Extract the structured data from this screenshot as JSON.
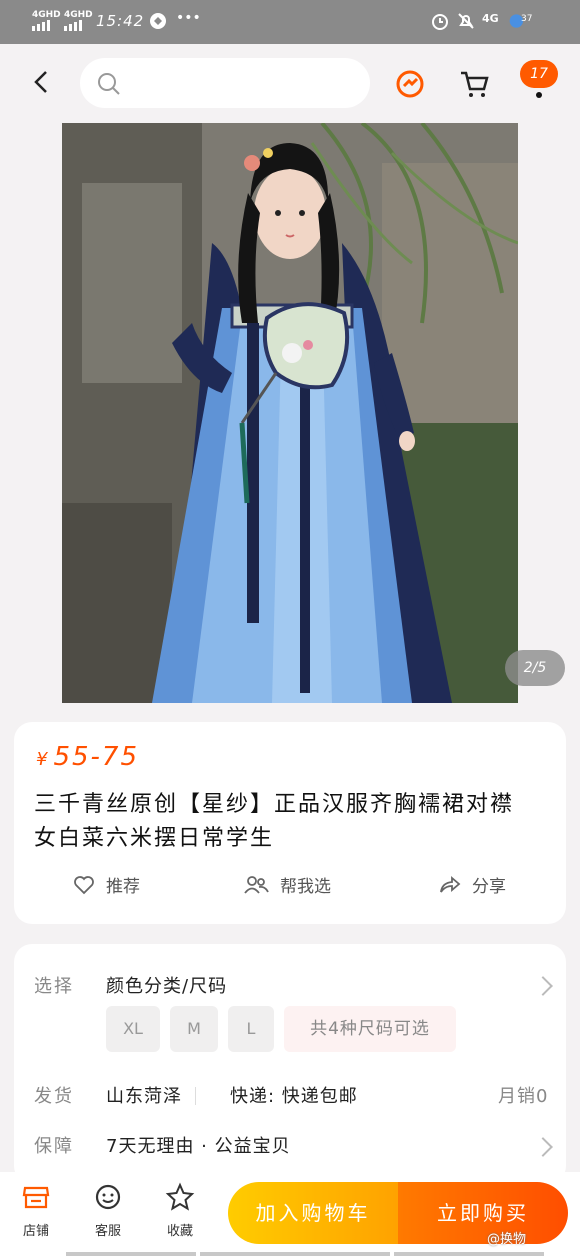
{
  "status_bar": {
    "signal1": "4GHD",
    "signal2": "4GHD",
    "time": "15:42",
    "more": "•••",
    "network": "4G",
    "battery": "37"
  },
  "header": {
    "search_placeholder": "",
    "cart_count": "17"
  },
  "gallery": {
    "counter": "2/5"
  },
  "product": {
    "currency": "¥",
    "price": "55-75",
    "title": "三千青丝原创【星纱】正品汉服齐胸襦裙对襟女白菜六米摆日常学生",
    "actions": [
      {
        "label": "推荐"
      },
      {
        "label": "帮我选"
      },
      {
        "label": "分享"
      }
    ]
  },
  "details": {
    "select_label": "选择",
    "select_value": "颜色分类/尺码",
    "sizes": [
      "XL",
      "M",
      "L"
    ],
    "more_sizes": "共4种尺码可选",
    "ship_label": "发货",
    "ship_from": "山东菏泽",
    "express": "快递: 快递包邮",
    "monthly_sales": "月销0",
    "guarantee_label": "保障",
    "guarantee_value": "7天无理由 · 公益宝贝"
  },
  "bottom": {
    "tabs": [
      {
        "label": "店铺"
      },
      {
        "label": "客服"
      },
      {
        "label": "收藏"
      }
    ],
    "add_cart": "加入购物车",
    "buy_now": "立即购买",
    "watermark": "@换物"
  },
  "colors": {
    "accent": "#ff5000",
    "cart_button": "#ffb400",
    "buy_button": "#ff5a00"
  }
}
